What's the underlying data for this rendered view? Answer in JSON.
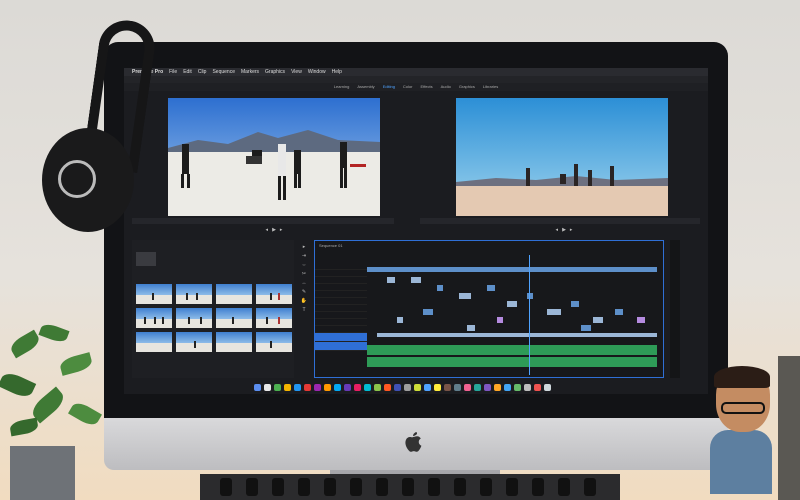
{
  "menubar": {
    "app": "Premiere Pro",
    "items": [
      "File",
      "Edit",
      "Clip",
      "Sequence",
      "Markers",
      "Graphics",
      "View",
      "Window",
      "Help"
    ]
  },
  "workspaces": [
    "Learning",
    "Assembly",
    "Editing",
    "Color",
    "Effects",
    "Audio",
    "Graphics",
    "Libraries"
  ],
  "active_workspace": "Editing",
  "timeline": {
    "title": "Sequence 01"
  },
  "colors": {
    "accent": "#4fa3ff",
    "video_clip": "#5d8fc9",
    "audio_clip": "#2e9b57",
    "purple_clip": "#b58be0"
  },
  "icons": [
    "headphones-icon",
    "apple-logo-icon",
    "play-icon",
    "razor-tool-icon",
    "dock-app-icon"
  ]
}
